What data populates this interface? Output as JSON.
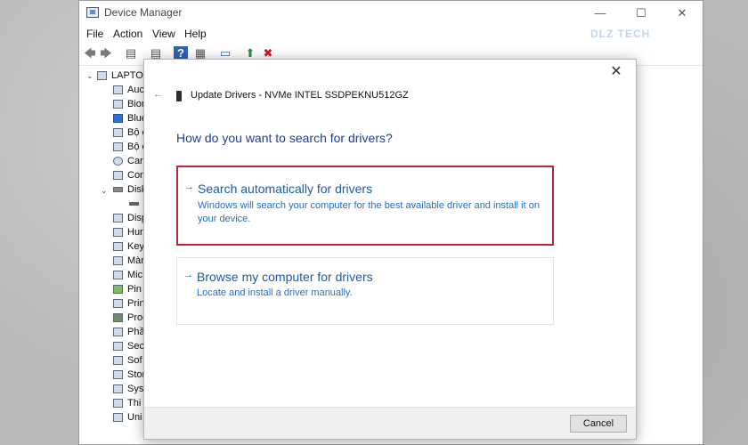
{
  "window": {
    "title": "Device Manager"
  },
  "menu": [
    "File",
    "Action",
    "View",
    "Help"
  ],
  "window_controls": {
    "minimize": "—",
    "maximize": "☐",
    "close": "✕"
  },
  "toolbar": {
    "icons": [
      "back-arrow-icon",
      "forward-arrow-icon",
      "properties-icon",
      "window-icon",
      "help-icon",
      "window-icon",
      "monitor-icon",
      "update-driver-icon",
      "uninstall-icon"
    ],
    "glyphs": [
      "🡄",
      "🡆",
      "▤",
      "▤",
      "?",
      "▦",
      "▭",
      "⬆",
      "✖"
    ]
  },
  "watermark": {
    "text": "DLZ TECH"
  },
  "tree": {
    "root": "LAPTOP",
    "items": [
      "Auc",
      "Bior",
      "Blue",
      "Bộ c",
      "Bộ c",
      "Carr",
      "Con",
      "Disk",
      "",
      "Disp",
      "Hur",
      "Key",
      "Màn",
      "Mic",
      "Pin",
      "Prin",
      "Proc",
      "Phầ",
      "Sec",
      "Sof",
      "Stor",
      "Syst",
      "Thi",
      "Uni"
    ]
  },
  "dialog": {
    "close_glyph": "✕",
    "back_glyph": "←",
    "title": "Update Drivers - NVMe INTEL SSDPEKNU512GZ",
    "question": "How do you want to search for drivers?",
    "options": [
      {
        "arrow": "→",
        "title": "Search automatically for drivers",
        "description": "Windows will search your computer for the best available driver and install it on your device."
      },
      {
        "arrow": "→",
        "title": "Browse my computer for drivers",
        "description": "Locate and install a driver manually."
      }
    ],
    "cancel_label": "Cancel"
  },
  "colors": {
    "highlight_border": "#c0262d",
    "link_blue": "#1b5aa6",
    "heading_blue": "#1a3f9a"
  }
}
